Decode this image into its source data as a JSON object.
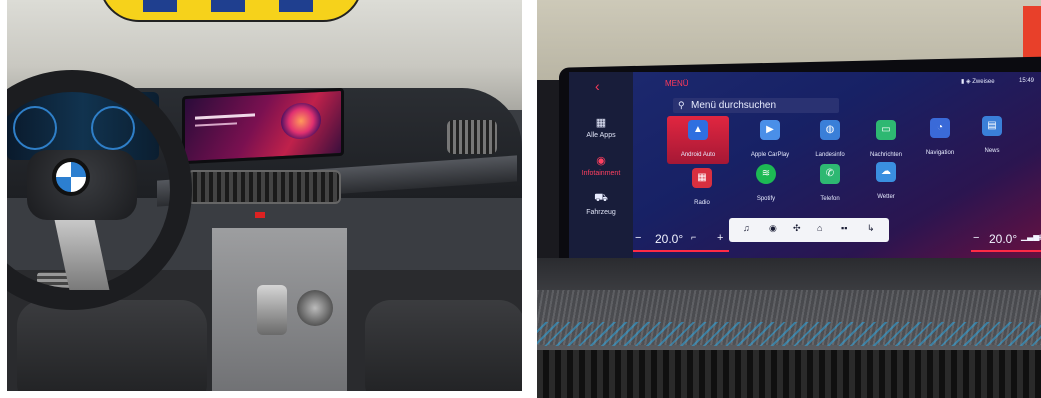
{
  "left_photo": {},
  "infotainment": {
    "sidebar": {
      "items": [
        {
          "label": "Alle Apps",
          "icon": "grid-icon",
          "active": false
        },
        {
          "label": "Infotainment",
          "icon": "media-icon",
          "active": true
        },
        {
          "label": "Fahrzeug",
          "icon": "car-icon",
          "active": false
        }
      ]
    },
    "header": {
      "title": "MENÜ",
      "search_placeholder": "Menü durchsuchen",
      "status_location": "Zweisee",
      "status_time": "15:49"
    },
    "apps": [
      {
        "label": "Android Auto",
        "icon": "android-auto-icon",
        "color": "#2f6fe0",
        "selected": true
      },
      {
        "label": "Apple CarPlay",
        "icon": "carplay-icon",
        "color": "#4a8fe8",
        "selected": false
      },
      {
        "label": "Landesinfo",
        "icon": "globe-icon",
        "color": "#3a7fd8",
        "selected": false
      },
      {
        "label": "Nachrichten",
        "icon": "message-icon",
        "color": "#2eb872",
        "selected": false
      },
      {
        "label": "Navigation",
        "icon": "navigation-icon",
        "color": "#3a6ad8",
        "selected": false
      },
      {
        "label": "News",
        "icon": "news-icon",
        "color": "#3a7fd8",
        "selected": false
      },
      {
        "label": "Radio",
        "icon": "radio-icon",
        "color": "#d83040",
        "selected": false
      },
      {
        "label": "Spotify",
        "icon": "spotify-icon",
        "color": "#1db954",
        "selected": false
      },
      {
        "label": "Telefon",
        "icon": "phone-icon",
        "color": "#2eb872",
        "selected": false
      },
      {
        "label": "Wetter",
        "icon": "weather-icon",
        "color": "#3a8fe0",
        "selected": false
      }
    ],
    "climate": {
      "left_temp": "20.0°",
      "right_temp": "20.0°",
      "minus": "−",
      "plus": "+"
    },
    "dock_icons": [
      "music-icon",
      "media-icon",
      "fan-icon",
      "home-icon",
      "apps-icon",
      "phone-icon"
    ],
    "accent_color": "#ff2a45"
  }
}
